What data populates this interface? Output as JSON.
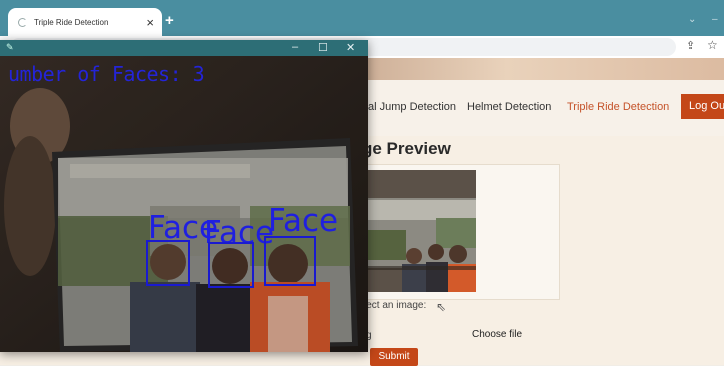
{
  "browser": {
    "tab_title": "Triple Ride Detection",
    "tab_close": "×",
    "new_tab": "+",
    "minimize": "⌄",
    "maximize": "–",
    "share_icon": "⇪",
    "star_icon": "☆"
  },
  "nav": {
    "items": [
      {
        "label": "al Jump Detection",
        "active": false
      },
      {
        "label": "Helmet Detection",
        "active": false
      },
      {
        "label": "Triple Ride Detection",
        "active": true
      }
    ],
    "logout": "Log Out"
  },
  "main": {
    "heading": "ge Preview",
    "select_label": "lect an image:",
    "file_row_prefix": "g",
    "choose_file": "Choose file",
    "submit": "Submit"
  },
  "cv_window": {
    "min": "–",
    "max": "☐",
    "close": "✕",
    "faces_count_text": "umber of Faces: 3",
    "face_labels": [
      "Face",
      "Face",
      "Face"
    ]
  },
  "colors": {
    "accent": "#c44718",
    "active_nav": "#c5532a",
    "detection_blue": "#1f1fe0"
  }
}
